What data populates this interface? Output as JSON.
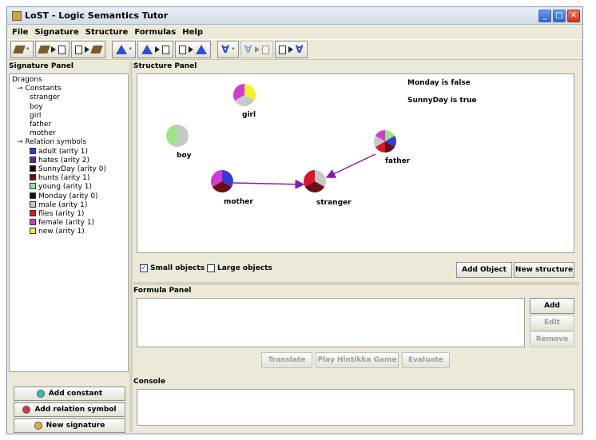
{
  "window": {
    "title": "LoST  - Logic Semantics Tutor"
  },
  "menu": [
    "File",
    "Signature",
    "Structure",
    "Formulas",
    "Help"
  ],
  "toolbar": {
    "star": "*"
  },
  "signature_panel": {
    "title": "Signature Panel",
    "root": "Dragons",
    "constants_label": "Constants",
    "constants": [
      "stranger",
      "boy",
      "girl",
      "father",
      "mother"
    ],
    "relations_label": "Relation symbols",
    "relations": [
      {
        "label": "adult (arity 1)",
        "color": "#3838d8"
      },
      {
        "label": "hates (arity 2)",
        "color": "#7a1aa0"
      },
      {
        "label": "SunnyDay (arity 0)",
        "color": "#111111"
      },
      {
        "label": "hunts (arity 1)",
        "color": "#6a0f14"
      },
      {
        "label": "young (arity 1)",
        "color": "#9fe28a"
      },
      {
        "label": "Monday (arity 0)",
        "color": "#111111"
      },
      {
        "label": "male (arity 1)",
        "color": "#c8c8c8"
      },
      {
        "label": "flies (arity 1)",
        "color": "#d8162c"
      },
      {
        "label": "female (arity 1)",
        "color": "#d03bd0"
      },
      {
        "label": "new (arity 1)",
        "color": "#f4f02a"
      }
    ],
    "buttons": {
      "add_constant": "Add constant",
      "add_relation": "Add relation symbol",
      "new_signature": "New signature"
    }
  },
  "structure_panel": {
    "title": "Structure Panel",
    "facts": [
      "Monday is false",
      "SunnyDay is true"
    ],
    "objects": [
      "girl",
      "boy",
      "father",
      "mother",
      "stranger"
    ],
    "small_objects_label": "Small objects",
    "small_objects_checked": true,
    "large_objects_label": "Large objects",
    "large_objects_checked": false,
    "add_object": "Add Object",
    "new_structure": "New structure"
  },
  "formula_panel": {
    "title": "Formula Panel",
    "add": "Add",
    "edit": "Edit",
    "remove": "Remove",
    "translate": "Translate",
    "play": "Play Hintikka Game",
    "evaluate": "Evaluate"
  },
  "console": {
    "title": "Console"
  }
}
